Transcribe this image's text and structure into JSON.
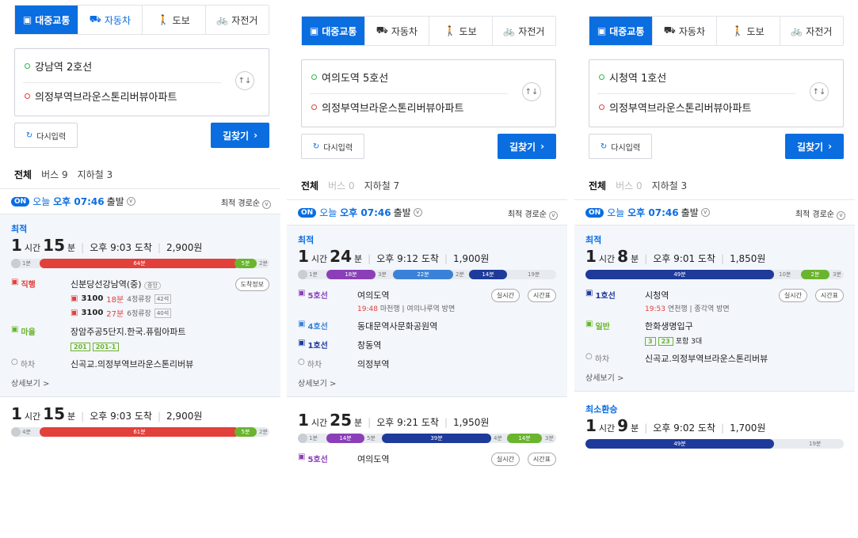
{
  "modes": [
    "대중교통",
    "자동차",
    "도보",
    "자전거"
  ],
  "swap_icon": "swap-vertical-icon",
  "reset_label": "다시입력",
  "find_label": "길찾기",
  "on_label": "ON",
  "today_label": "오늘",
  "depart_time": "오후 07:46",
  "depart_suffix": "출발",
  "sort_label": "최적 경로순",
  "more_label": "상세보기 >",
  "colors": {
    "accent": "#0a6de0",
    "red_bus": "#e2403b",
    "green_bus": "#6ab42e",
    "line1": "#1e3a9a",
    "line4": "#3a82d8",
    "line5": "#8a3fb8"
  },
  "panels": [
    {
      "origin": "강남역 2호선",
      "destination": "의정부역브라운스톤리버뷰아파트",
      "tabs": [
        {
          "label": "전체"
        },
        {
          "label": "버스 9"
        },
        {
          "label": "지하철 3"
        }
      ],
      "cards": [
        {
          "tag": "최적",
          "hours": "1",
          "hour_unit": "시간",
          "minutes": "15",
          "minute_unit": "분",
          "arrive": "오후 9:03 도착",
          "fare": "2,900원",
          "bar": {
            "walk1": "1분",
            "seg1": "64분",
            "seg2": "5분",
            "walk2": "2분"
          },
          "steps": [
            {
              "type": "직행",
              "stop": "신분당선강남역(중)",
              "dir": "중앙",
              "pill": "도착정보",
              "buses": [
                {
                  "num": "3100",
                  "min": "18분",
                  "stops": "4정류장",
                  "seat": "42석"
                },
                {
                  "num": "3100",
                  "min": "27분",
                  "stops": "6정류장",
                  "seat": "40석"
                }
              ]
            },
            {
              "type": "마을",
              "stop": "장암주공5단지.한국.퓨림아파트",
              "routes": [
                "201",
                "201-1"
              ]
            },
            {
              "type": "하차",
              "stop": "신곡교.의정부역브라운스톤리버뷰"
            }
          ]
        },
        {
          "hours": "1",
          "hour_unit": "시간",
          "minutes": "15",
          "minute_unit": "분",
          "arrive": "오후 9:03 도착",
          "fare": "2,900원",
          "bar": {
            "walk1": "4분",
            "seg1": "61분",
            "seg2": "5분",
            "walk2": "2분"
          }
        }
      ]
    },
    {
      "origin": "여의도역 5호선",
      "destination": "의정부역브라운스톤리버뷰아파트",
      "tabs": [
        {
          "label": "전체"
        },
        {
          "label": "버스 0"
        },
        {
          "label": "지하철 7"
        }
      ],
      "cards": [
        {
          "tag": "최적",
          "hours": "1",
          "hour_unit": "시간",
          "minutes": "24",
          "minute_unit": "분",
          "arrive": "오후 9:12 도착",
          "fare": "1,900원",
          "bar": {
            "walk1": "1분",
            "seg1": "18분",
            "w2": "3분",
            "seg2": "22분",
            "w3": "2분",
            "seg3": "14분",
            "seg4": "19분"
          },
          "steps": [
            {
              "type": "5호선",
              "stop": "여의도역",
              "pills": [
                "실시간",
                "시간표"
              ],
              "time": "19:48",
              "info": "마천행 | 여의나루역 방면"
            },
            {
              "type": "4호선",
              "stop": "동대문역사문화공원역"
            },
            {
              "type": "1호선",
              "stop": "창동역"
            },
            {
              "type": "하차",
              "stop": "의정부역"
            }
          ]
        },
        {
          "hours": "1",
          "hour_unit": "시간",
          "minutes": "25",
          "minute_unit": "분",
          "arrive": "오후 9:21 도착",
          "fare": "1,950원",
          "bar": {
            "walk1": "1분",
            "seg1": "14분",
            "w2": "5분",
            "seg2": "39분",
            "w3": "4분",
            "seg3": "14분",
            "w4": "3분"
          },
          "steps": [
            {
              "type": "5호선",
              "stop": "여의도역",
              "pills": [
                "실시간",
                "시간표"
              ]
            }
          ]
        }
      ]
    },
    {
      "origin": "시청역 1호선",
      "destination": "의정부역브라운스톤리버뷰아파트",
      "tabs": [
        {
          "label": "전체"
        },
        {
          "label": "버스 0"
        },
        {
          "label": "지하철 3"
        }
      ],
      "cards": [
        {
          "tag": "최적",
          "hours": "1",
          "hour_unit": "시간",
          "minutes": "8",
          "minute_unit": "분",
          "arrive": "오후 9:01 도착",
          "fare": "1,850원",
          "bar": {
            "seg1": "49분",
            "mid": "10분",
            "seg2": "2분",
            "walk2": "3분"
          },
          "steps": [
            {
              "type": "1호선",
              "stop": "시청역",
              "pills": [
                "실시간",
                "시간표"
              ],
              "time": "19:53",
              "info": "연천행 | 종각역 방면"
            },
            {
              "type": "일반",
              "stop": "한화생명입구",
              "routes": [
                "3",
                "23"
              ],
              "extra": "포함 3대"
            },
            {
              "type": "하차",
              "stop": "신곡교.의정부역브라운스톤리버뷰"
            }
          ]
        },
        {
          "tag": "최소환승",
          "hours": "1",
          "hour_unit": "시간",
          "minutes": "9",
          "minute_unit": "분",
          "arrive": "오후 9:02 도착",
          "fare": "1,700원",
          "bar": {
            "seg1": "49분",
            "mid": "19분"
          }
        }
      ]
    }
  ]
}
